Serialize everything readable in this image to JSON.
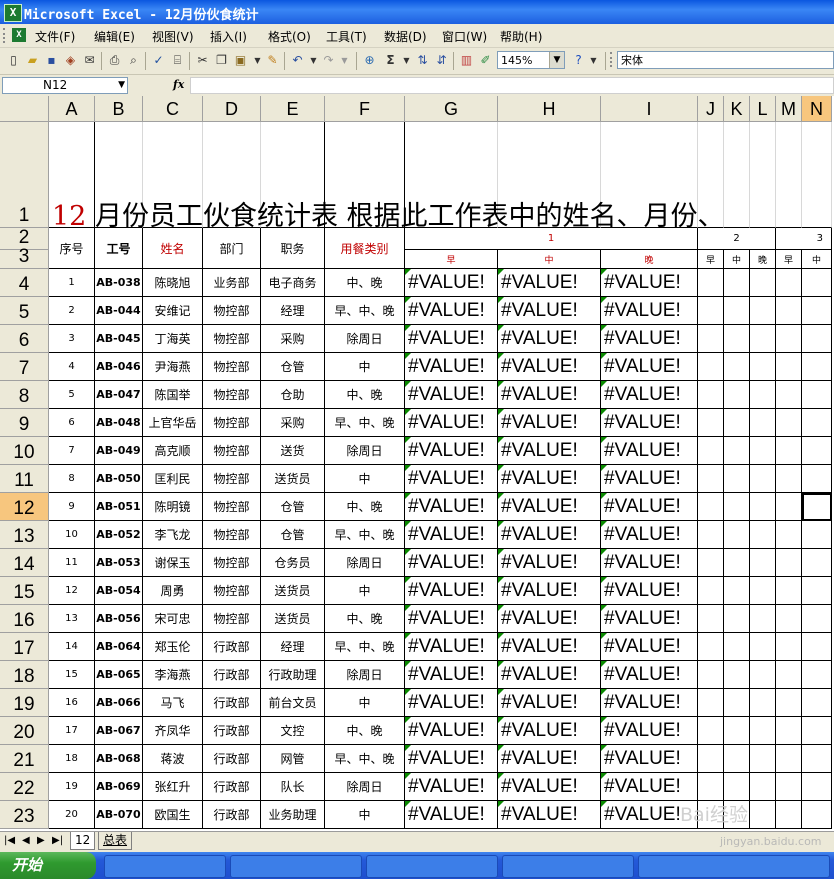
{
  "window": {
    "title": "Microsoft Excel - 12月份伙食统计",
    "app_icon": "excel-icon"
  },
  "menu": [
    "文件(F)",
    "编辑(E)",
    "视图(V)",
    "插入(I)",
    "格式(O)",
    "工具(T)",
    "数据(D)",
    "窗口(W)",
    "帮助(H)"
  ],
  "toolbar": {
    "zoom": "145%",
    "font": "宋体",
    "sum_symbol": "Σ"
  },
  "formula_bar": {
    "name_box": "N12",
    "fx_label": "fx",
    "content": ""
  },
  "column_headers": [
    "A",
    "B",
    "C",
    "D",
    "E",
    "F",
    "G",
    "H",
    "I",
    "J",
    "K",
    "L",
    "M",
    "N"
  ],
  "selected": {
    "column": "N",
    "row": "12"
  },
  "title_row": {
    "number": "12",
    "text": " 月份员工伙食统计表  根据此工作表中的姓名、月份、"
  },
  "table_headers": {
    "seq": "序号",
    "id": "工号",
    "name": "姓名",
    "dept": "部门",
    "position": "职务",
    "meal_type": "用餐类别"
  },
  "day_groups": [
    "1",
    "2",
    "3"
  ],
  "meals": [
    "早",
    "中",
    "晚"
  ],
  "rows": [
    {
      "row": "4",
      "seq": "1",
      "id": "AB-038",
      "name": "陈晓旭",
      "dept": "业务部",
      "position": "电子商务",
      "meal": "中、晚"
    },
    {
      "row": "5",
      "seq": "2",
      "id": "AB-044",
      "name": "安维记",
      "dept": "物控部",
      "position": "经理",
      "meal": "早、中、晚"
    },
    {
      "row": "6",
      "seq": "3",
      "id": "AB-045",
      "name": "丁海英",
      "dept": "物控部",
      "position": "采购",
      "meal": "除周日"
    },
    {
      "row": "7",
      "seq": "4",
      "id": "AB-046",
      "name": "尹海燕",
      "dept": "物控部",
      "position": "仓管",
      "meal": "中"
    },
    {
      "row": "8",
      "seq": "5",
      "id": "AB-047",
      "name": "陈国举",
      "dept": "物控部",
      "position": "仓助",
      "meal": "中、晚"
    },
    {
      "row": "9",
      "seq": "6",
      "id": "AB-048",
      "name": "上官华岳",
      "dept": "物控部",
      "position": "采购",
      "meal": "早、中、晚"
    },
    {
      "row": "10",
      "seq": "7",
      "id": "AB-049",
      "name": "高克顺",
      "dept": "物控部",
      "position": "送货",
      "meal": "除周日"
    },
    {
      "row": "11",
      "seq": "8",
      "id": "AB-050",
      "name": "匡利民",
      "dept": "物控部",
      "position": "送货员",
      "meal": "中"
    },
    {
      "row": "12",
      "seq": "9",
      "id": "AB-051",
      "name": "陈明镜",
      "dept": "物控部",
      "position": "仓管",
      "meal": "中、晚"
    },
    {
      "row": "13",
      "seq": "10",
      "id": "AB-052",
      "name": "李飞龙",
      "dept": "物控部",
      "position": "仓管",
      "meal": "早、中、晚"
    },
    {
      "row": "14",
      "seq": "11",
      "id": "AB-053",
      "name": "谢保玉",
      "dept": "物控部",
      "position": "仓务员",
      "meal": "除周日"
    },
    {
      "row": "15",
      "seq": "12",
      "id": "AB-054",
      "name": "周勇",
      "dept": "物控部",
      "position": "送货员",
      "meal": "中"
    },
    {
      "row": "16",
      "seq": "13",
      "id": "AB-056",
      "name": "宋可忠",
      "dept": "物控部",
      "position": "送货员",
      "meal": "中、晚"
    },
    {
      "row": "17",
      "seq": "14",
      "id": "AB-064",
      "name": "郑玉伦",
      "dept": "行政部",
      "position": "经理",
      "meal": "早、中、晚"
    },
    {
      "row": "18",
      "seq": "15",
      "id": "AB-065",
      "name": "李海燕",
      "dept": "行政部",
      "position": "行政助理",
      "meal": "除周日"
    },
    {
      "row": "19",
      "seq": "16",
      "id": "AB-066",
      "name": "马飞",
      "dept": "行政部",
      "position": "前台文员",
      "meal": "中"
    },
    {
      "row": "20",
      "seq": "17",
      "id": "AB-067",
      "name": "齐凤华",
      "dept": "行政部",
      "position": "文控",
      "meal": "中、晚"
    },
    {
      "row": "21",
      "seq": "18",
      "id": "AB-068",
      "name": "蒋波",
      "dept": "行政部",
      "position": "网管",
      "meal": "早、中、晚"
    },
    {
      "row": "22",
      "seq": "19",
      "id": "AB-069",
      "name": "张红升",
      "dept": "行政部",
      "position": "队长",
      "meal": "除周日"
    },
    {
      "row": "23",
      "seq": "20",
      "id": "AB-070",
      "name": "欧国生",
      "dept": "行政部",
      "position": "业务助理",
      "meal": "中"
    }
  ],
  "error_value": "#VALUE!",
  "header_rows": [
    "1",
    "2",
    "3"
  ],
  "sheet_tabs": [
    "12",
    "总表"
  ],
  "active_sheet": "12",
  "taskbar": {
    "start": "开始"
  },
  "watermark": {
    "main": "Bai经验",
    "url": "jingyan.baidu.com"
  }
}
